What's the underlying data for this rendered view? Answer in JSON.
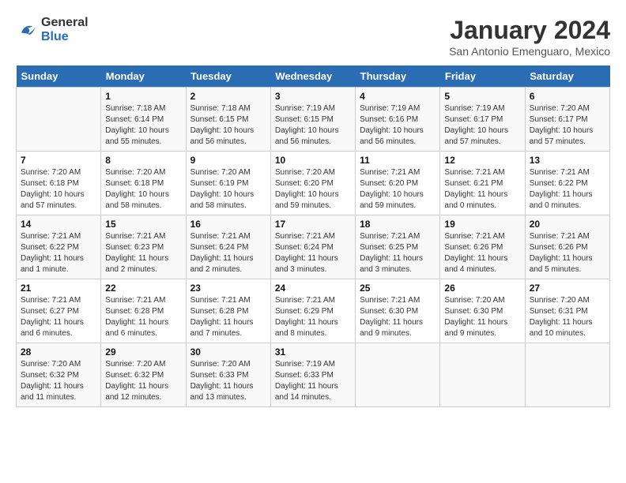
{
  "header": {
    "logo_line1": "General",
    "logo_line2": "Blue",
    "title": "January 2024",
    "subtitle": "San Antonio Emenguaro, Mexico"
  },
  "weekdays": [
    "Sunday",
    "Monday",
    "Tuesday",
    "Wednesday",
    "Thursday",
    "Friday",
    "Saturday"
  ],
  "weeks": [
    [
      {
        "day": "",
        "info": ""
      },
      {
        "day": "1",
        "info": "Sunrise: 7:18 AM\nSunset: 6:14 PM\nDaylight: 10 hours\nand 55 minutes."
      },
      {
        "day": "2",
        "info": "Sunrise: 7:18 AM\nSunset: 6:15 PM\nDaylight: 10 hours\nand 56 minutes."
      },
      {
        "day": "3",
        "info": "Sunrise: 7:19 AM\nSunset: 6:15 PM\nDaylight: 10 hours\nand 56 minutes."
      },
      {
        "day": "4",
        "info": "Sunrise: 7:19 AM\nSunset: 6:16 PM\nDaylight: 10 hours\nand 56 minutes."
      },
      {
        "day": "5",
        "info": "Sunrise: 7:19 AM\nSunset: 6:17 PM\nDaylight: 10 hours\nand 57 minutes."
      },
      {
        "day": "6",
        "info": "Sunrise: 7:20 AM\nSunset: 6:17 PM\nDaylight: 10 hours\nand 57 minutes."
      }
    ],
    [
      {
        "day": "7",
        "info": "Sunrise: 7:20 AM\nSunset: 6:18 PM\nDaylight: 10 hours\nand 57 minutes."
      },
      {
        "day": "8",
        "info": "Sunrise: 7:20 AM\nSunset: 6:18 PM\nDaylight: 10 hours\nand 58 minutes."
      },
      {
        "day": "9",
        "info": "Sunrise: 7:20 AM\nSunset: 6:19 PM\nDaylight: 10 hours\nand 58 minutes."
      },
      {
        "day": "10",
        "info": "Sunrise: 7:20 AM\nSunset: 6:20 PM\nDaylight: 10 hours\nand 59 minutes."
      },
      {
        "day": "11",
        "info": "Sunrise: 7:21 AM\nSunset: 6:20 PM\nDaylight: 10 hours\nand 59 minutes."
      },
      {
        "day": "12",
        "info": "Sunrise: 7:21 AM\nSunset: 6:21 PM\nDaylight: 11 hours\nand 0 minutes."
      },
      {
        "day": "13",
        "info": "Sunrise: 7:21 AM\nSunset: 6:22 PM\nDaylight: 11 hours\nand 0 minutes."
      }
    ],
    [
      {
        "day": "14",
        "info": "Sunrise: 7:21 AM\nSunset: 6:22 PM\nDaylight: 11 hours\nand 1 minute."
      },
      {
        "day": "15",
        "info": "Sunrise: 7:21 AM\nSunset: 6:23 PM\nDaylight: 11 hours\nand 2 minutes."
      },
      {
        "day": "16",
        "info": "Sunrise: 7:21 AM\nSunset: 6:24 PM\nDaylight: 11 hours\nand 2 minutes."
      },
      {
        "day": "17",
        "info": "Sunrise: 7:21 AM\nSunset: 6:24 PM\nDaylight: 11 hours\nand 3 minutes."
      },
      {
        "day": "18",
        "info": "Sunrise: 7:21 AM\nSunset: 6:25 PM\nDaylight: 11 hours\nand 3 minutes."
      },
      {
        "day": "19",
        "info": "Sunrise: 7:21 AM\nSunset: 6:26 PM\nDaylight: 11 hours\nand 4 minutes."
      },
      {
        "day": "20",
        "info": "Sunrise: 7:21 AM\nSunset: 6:26 PM\nDaylight: 11 hours\nand 5 minutes."
      }
    ],
    [
      {
        "day": "21",
        "info": "Sunrise: 7:21 AM\nSunset: 6:27 PM\nDaylight: 11 hours\nand 6 minutes."
      },
      {
        "day": "22",
        "info": "Sunrise: 7:21 AM\nSunset: 6:28 PM\nDaylight: 11 hours\nand 6 minutes."
      },
      {
        "day": "23",
        "info": "Sunrise: 7:21 AM\nSunset: 6:28 PM\nDaylight: 11 hours\nand 7 minutes."
      },
      {
        "day": "24",
        "info": "Sunrise: 7:21 AM\nSunset: 6:29 PM\nDaylight: 11 hours\nand 8 minutes."
      },
      {
        "day": "25",
        "info": "Sunrise: 7:21 AM\nSunset: 6:30 PM\nDaylight: 11 hours\nand 9 minutes."
      },
      {
        "day": "26",
        "info": "Sunrise: 7:20 AM\nSunset: 6:30 PM\nDaylight: 11 hours\nand 9 minutes."
      },
      {
        "day": "27",
        "info": "Sunrise: 7:20 AM\nSunset: 6:31 PM\nDaylight: 11 hours\nand 10 minutes."
      }
    ],
    [
      {
        "day": "28",
        "info": "Sunrise: 7:20 AM\nSunset: 6:32 PM\nDaylight: 11 hours\nand 11 minutes."
      },
      {
        "day": "29",
        "info": "Sunrise: 7:20 AM\nSunset: 6:32 PM\nDaylight: 11 hours\nand 12 minutes."
      },
      {
        "day": "30",
        "info": "Sunrise: 7:20 AM\nSunset: 6:33 PM\nDaylight: 11 hours\nand 13 minutes."
      },
      {
        "day": "31",
        "info": "Sunrise: 7:19 AM\nSunset: 6:33 PM\nDaylight: 11 hours\nand 14 minutes."
      },
      {
        "day": "",
        "info": ""
      },
      {
        "day": "",
        "info": ""
      },
      {
        "day": "",
        "info": ""
      }
    ]
  ]
}
